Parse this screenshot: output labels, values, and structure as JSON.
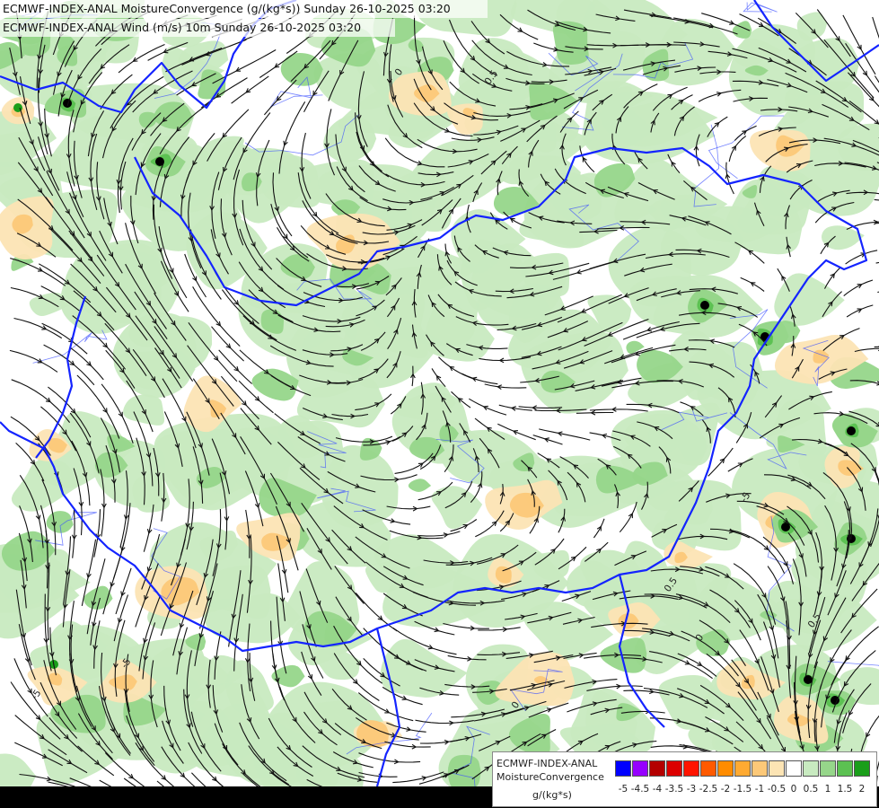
{
  "titles": {
    "line1": "ECMWF-INDEX-ANAL MoistureConvergence (g/(kg*s)) Sunday 26-10-2025 03:20",
    "line2": "ECMWF-INDEX-ANAL Wind (m/s) 10m Sunday 26-10-2025 03:20"
  },
  "legend": {
    "model": "ECMWF-INDEX-ANAL",
    "parameter": "MoistureConvergence",
    "unit": "g/(kg*s)",
    "classes": [
      {
        "label": "-5",
        "color": "#0000ff"
      },
      {
        "label": "-4.5",
        "color": "#9600ff"
      },
      {
        "label": "-4",
        "color": "#b40000"
      },
      {
        "label": "-3.5",
        "color": "#dc0000"
      },
      {
        "label": "-3",
        "color": "#ff1400"
      },
      {
        "label": "-2.5",
        "color": "#ff5a00"
      },
      {
        "label": "-2",
        "color": "#ff8c00"
      },
      {
        "label": "-1.5",
        "color": "#ffaa32"
      },
      {
        "label": "-1",
        "color": "#fcc878"
      },
      {
        "label": "-0.5",
        "color": "#fce4b4"
      },
      {
        "label": "0",
        "color": "#ffffff"
      },
      {
        "label": "0.5",
        "color": "#c8eac0"
      },
      {
        "label": "1",
        "color": "#96d68a"
      },
      {
        "label": "1.5",
        "color": "#5cc152"
      },
      {
        "label": "2",
        "color": "#1a9e1a"
      }
    ]
  },
  "map": {
    "border_color": "#1424ff",
    "river_color": "#3c50ff",
    "streamline_color": "#111111",
    "background_color": "#ffffff",
    "contour_labels": [
      "0",
      "0.5",
      "-5",
      "-5",
      "0.5",
      "0",
      "0.5",
      "0",
      "-5"
    ]
  }
}
